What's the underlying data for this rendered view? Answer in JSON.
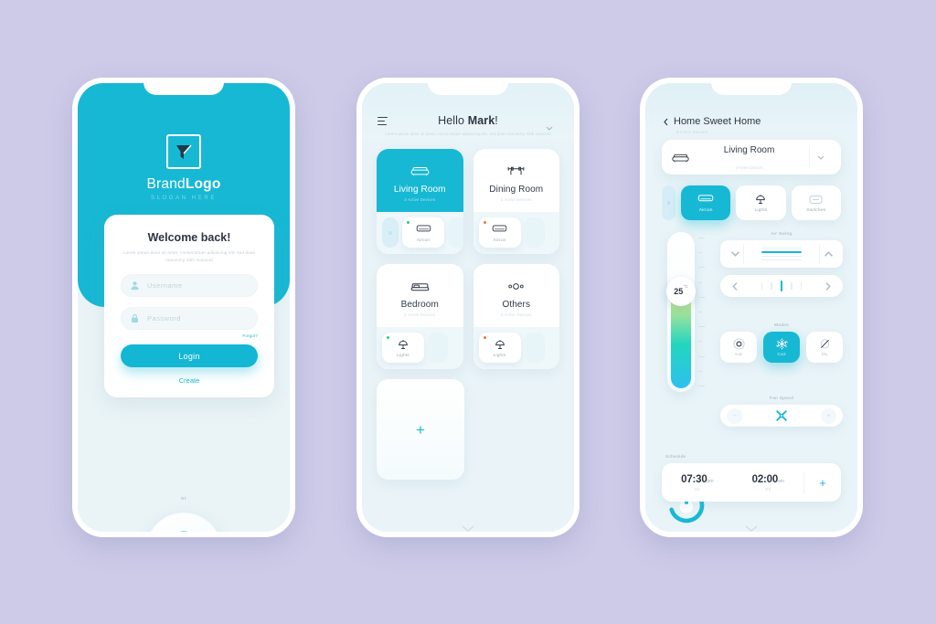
{
  "theme": {
    "background": "#cdcbe8",
    "accent": "#17b8d4",
    "accent_dark": "#13b7d3",
    "on_color": "#26d07c",
    "off_color": "#f2704e"
  },
  "login_screen": {
    "brand_first": "Brand",
    "brand_second": "Logo",
    "slogan": "SLOGAN HERE",
    "welcome_title": "Welcome back!",
    "description": "Lorem ipsum dolor sit amet, consectetuer adipiscing elit, sed diam nonummy nibh euismod",
    "username_placeholder": "Username",
    "password_placeholder": "Password",
    "forgot_label": "Forgot?",
    "login_label": "Login",
    "create_label": "Create",
    "or_label": "or",
    "fingerprint_hint": "fingerprint-scanner"
  },
  "rooms_screen": {
    "greeting_prefix": "Hello ",
    "greeting_name": "Mark",
    "greeting_suffix": "!",
    "description": "Lorem ipsum dolor sit amet, consectetuer adipiscing elit, sed diam nonummy nibh euismod",
    "add_label": "+",
    "rooms": [
      {
        "name": "Living Room",
        "subtitle": "3 Active Devices",
        "icon": "sofa-icon",
        "active": true,
        "devices": [
          {
            "label": "Aircon",
            "icon": "aircon-icon",
            "status": "on"
          }
        ]
      },
      {
        "name": "Dining Room",
        "subtitle": "1 Active Devices",
        "icon": "dining-table-icon",
        "active": false,
        "devices": [
          {
            "label": "Aircon",
            "icon": "aircon-icon",
            "status": "off"
          }
        ]
      },
      {
        "name": "Bedroom",
        "subtitle": "2 Active Devices",
        "icon": "bed-icon",
        "active": false,
        "devices": [
          {
            "label": "Lights",
            "icon": "lamp-icon",
            "status": "on"
          }
        ]
      },
      {
        "name": "Others",
        "subtitle": "2 Active Devices",
        "icon": "dots-icon",
        "active": false,
        "devices": [
          {
            "label": "Lights",
            "icon": "lamp-icon",
            "status": "off"
          }
        ]
      }
    ]
  },
  "aircon_screen": {
    "title": "Home Sweet Home",
    "subtitle": "8 Active Devices",
    "selected_room": {
      "name": "Living Room",
      "subtitle": "3 Active Devices",
      "icon": "sofa-icon"
    },
    "tabs": [
      {
        "label": "Aircon",
        "icon": "aircon-icon",
        "active": true
      },
      {
        "label": "Lights",
        "icon": "lamp-icon",
        "active": false
      },
      {
        "label": "Switches",
        "icon": "switch-icon",
        "active": false
      }
    ],
    "temperature": {
      "value": "25",
      "unit": "°C"
    },
    "air_swing_label": "Air Swing",
    "modes_label": "Modes",
    "modes": [
      {
        "label": "Auto",
        "icon": "auto-circle-icon",
        "active": false
      },
      {
        "label": "Cool",
        "icon": "snowflake-icon",
        "active": true
      },
      {
        "label": "Dry",
        "icon": "dry-leaf-icon",
        "active": false
      }
    ],
    "fan_speed_label": "Fan Speed",
    "fan_minus": "−",
    "fan_plus": "+",
    "schedule_label": "Schedule",
    "schedule": [
      {
        "time": "07:30",
        "meridiem": "pm",
        "state": "On"
      },
      {
        "time": "02:00",
        "meridiem": "am",
        "state": "Off"
      }
    ],
    "schedule_add": "+"
  }
}
